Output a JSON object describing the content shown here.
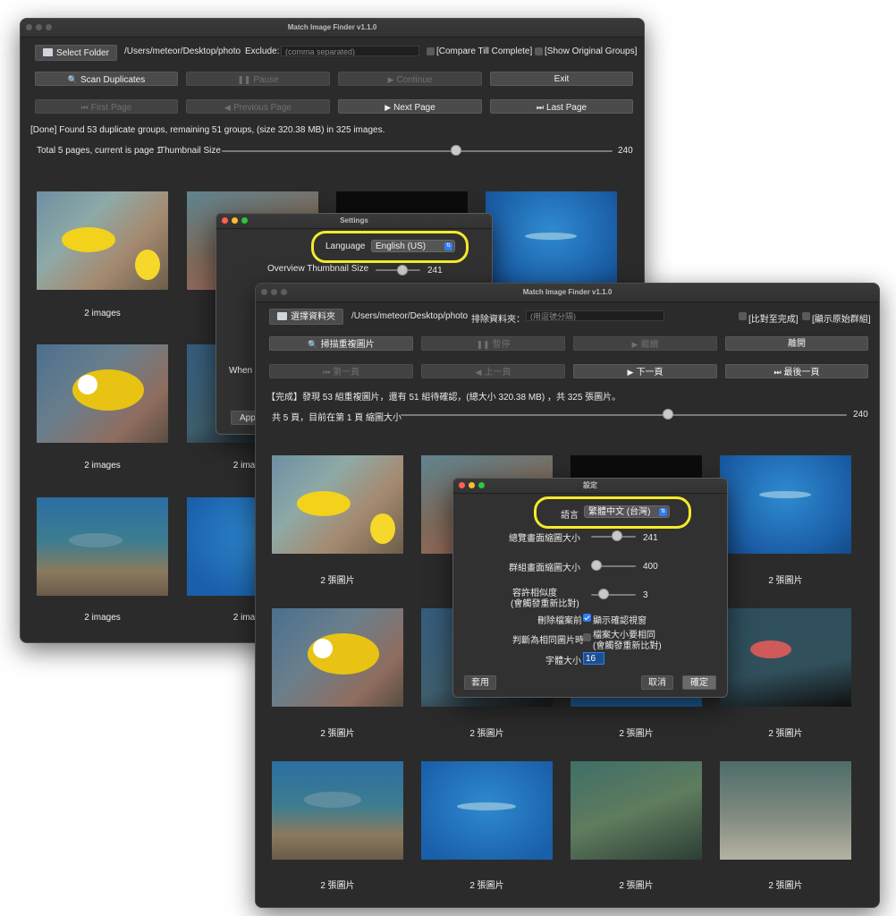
{
  "back_window": {
    "title": "Match Image Finder v1.1.0",
    "select_folder": "Select Folder",
    "path": "/Users/meteor/Desktop/photo",
    "exclude_label": "Exclude:",
    "exclude_placeholder": "(comma separated)",
    "compare_label": "[Compare Till Complete]",
    "show_groups_label": "[Show Original Groups]",
    "scan": "Scan Duplicates",
    "pause": "Pause",
    "continue": "Continue",
    "exit": "Exit",
    "first_page": "First Page",
    "previous_page": "Previous Page",
    "next_page": "Next Page",
    "last_page": "Last Page",
    "status": "[Done] Found 53 duplicate groups, remaining 51 groups, (size 320.38 MB) in 325 images.",
    "pages_info": "Total 5 pages, current is page 1",
    "thumb_size_label": "Thumbnail Size",
    "thumb_size_value": "240",
    "thumb_size_level": 0.6,
    "captions": [
      "2 images",
      "2 ima",
      "2 images",
      "2 ima",
      "2 images",
      "2 ima"
    ]
  },
  "back_settings": {
    "title": "Settings",
    "language_label": "Language",
    "language_value": "English (US)",
    "overview_label": "Overview Thumbnail Size",
    "overview_value": "241",
    "when_label": "When",
    "apply_label": "Appl"
  },
  "front_window": {
    "title": "Match Image Finder v1.1.0",
    "select_folder": "選擇資料夾",
    "path": "/Users/meteor/Desktop/photo",
    "exclude_label": "排除資料夾：",
    "exclude_placeholder": "(用逗號分隔)",
    "compare_label": "[比對至完成]",
    "show_groups_label": "[顯示原始群組]",
    "scan": "掃描重複圖片",
    "pause": "暫停",
    "continue": "繼續",
    "exit": "離開",
    "first_page": "第一頁",
    "previous_page": "上一頁",
    "next_page": "下一頁",
    "last_page": "最後一頁",
    "status": "【完成】發現 53 組重複圖片，還有 51 組待確認，(總大小 320.38 MB) ，共 325 張圖片。",
    "pages_info": "共 5 頁，目前在第 1 頁 縮圖大小",
    "thumb_size_value": "240",
    "thumb_size_level": 0.6,
    "captions": [
      "2 張圖片",
      "2 張圖片",
      "2 張圖片",
      "2 張圖片",
      "2 張圖片",
      "2 張圖片",
      "2 張圖片",
      "2 張圖片",
      "2 張圖片",
      "2 張圖片",
      "2 張圖片",
      "2 張圖片"
    ]
  },
  "front_settings": {
    "title": "設定",
    "language_label": "語言",
    "language_value": "繁體中文 (台灣)",
    "overview_label": "總覽畫面縮圖大小",
    "overview_value": "241",
    "overview_level": 0.55,
    "group_label": "群組畫面縮圖大小",
    "group_value": "400",
    "group_level": 0.1,
    "similarity_label_1": "容許相似度",
    "similarity_label_2": "(會觸發重新比對)",
    "similarity_value": "3",
    "similarity_level": 0.3,
    "delete_label": "刪除檔案前",
    "delete_check_label": "顯示確認視窗",
    "same_label": "判斷為相同圖片時",
    "same_check_label_1": "檔案大小要相同",
    "same_check_label_2": "(會觸發重新比對)",
    "font_label": "字體大小",
    "font_value": "16",
    "apply": "套用",
    "cancel": "取消",
    "ok": "確定"
  }
}
